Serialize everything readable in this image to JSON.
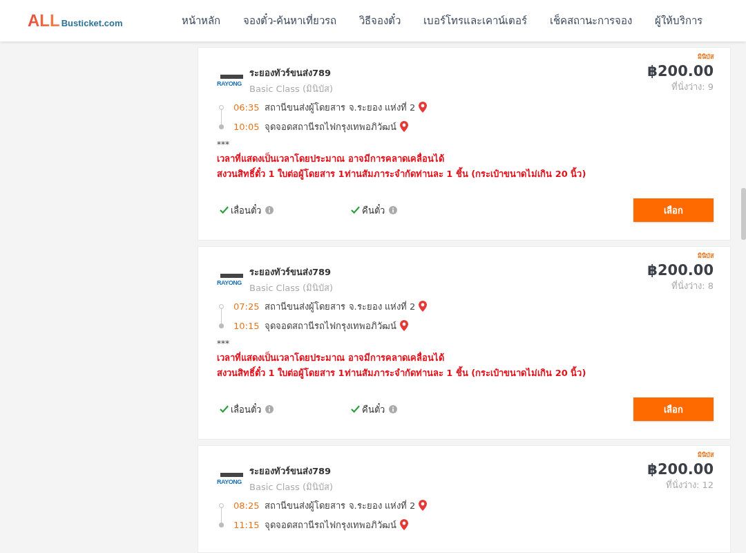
{
  "header": {
    "logo": {
      "main": "ALL",
      "sub": "Busticket.com"
    },
    "nav": [
      {
        "label": "หน้าหลัก"
      },
      {
        "label": "จองตั๋ว-ค้นหาเที่ยวรถ"
      },
      {
        "label": "วิธีจองตั๋ว"
      },
      {
        "label": "เบอร์โทรและเคาน์เตอร์"
      },
      {
        "label": "เช็คสถานะการจอง"
      },
      {
        "label": "ผู้ให้บริการ"
      }
    ]
  },
  "trips": [
    {
      "tag": "มินิบัส",
      "logo_text": "RAYONG",
      "operator": "ระยองทัวร์ขนส่ง789",
      "class": "Basic Class (มินิบัส)",
      "price": "฿200.00",
      "seats": "ที่นั่งว่าง: 9",
      "stops": [
        {
          "kind": "departure",
          "time": "06:35",
          "place": "สถานีขนส่งผู้โดยสาร จ.ระยอง แห่งที่ 2"
        },
        {
          "kind": "arrival",
          "time": "10:05",
          "place": "จุดจอดสถานีรถไฟกรุงเทพอภิวัฒน์"
        }
      ],
      "note_mark": "***",
      "notes": [
        "เวลาที่แสดงเป็นเวลาโดยประมาณ อาจมีการคลาดเคลื่อนได้",
        "สงวนสิทธิ์ตั๋ว 1 ใบต่อผู้โดยสาร 1ท่านสัมภาระจำกัดท่านละ 1 ชิ้น (กระเป๋าขนาดไม่เกิน 20 นิ้ว)"
      ],
      "features": [
        {
          "label": "เลื่อนตั๋ว",
          "checked": true
        },
        {
          "label": "คืนตั๋ว",
          "checked": true
        }
      ],
      "button": "เลือก"
    },
    {
      "tag": "มินิบัส",
      "logo_text": "RAYONG",
      "operator": "ระยองทัวร์ขนส่ง789",
      "class": "Basic Class (มินิบัส)",
      "price": "฿200.00",
      "seats": "ที่นั่งว่าง: 8",
      "stops": [
        {
          "kind": "departure",
          "time": "07:25",
          "place": "สถานีขนส่งผู้โดยสาร จ.ระยอง แห่งที่ 2"
        },
        {
          "kind": "arrival",
          "time": "10:15",
          "place": "จุดจอดสถานีรถไฟกรุงเทพอภิวัฒน์"
        }
      ],
      "note_mark": "***",
      "notes": [
        "เวลาที่แสดงเป็นเวลาโดยประมาณ อาจมีการคลาดเคลื่อนได้",
        "สงวนสิทธิ์ตั๋ว 1 ใบต่อผู้โดยสาร 1ท่านสัมภาระจำกัดท่านละ 1 ชิ้น (กระเป๋าขนาดไม่เกิน 20 นิ้ว)"
      ],
      "features": [
        {
          "label": "เลื่อนตั๋ว",
          "checked": true
        },
        {
          "label": "คืนตั๋ว",
          "checked": true
        }
      ],
      "button": "เลือก"
    },
    {
      "tag": "มินิบัส",
      "logo_text": "RAYONG",
      "operator": "ระยองทัวร์ขนส่ง789",
      "class": "Basic Class (มินิบัส)",
      "price": "฿200.00",
      "seats": "ที่นั่งว่าง: 12",
      "stops": [
        {
          "kind": "departure",
          "time": "08:25",
          "place": "สถานีขนส่งผู้โดยสาร จ.ระยอง แห่งที่ 2"
        },
        {
          "kind": "arrival",
          "time": "11:15",
          "place": "จุดจอดสถานีรถไฟกรุงเทพอภิวัฒน์"
        }
      ]
    }
  ]
}
